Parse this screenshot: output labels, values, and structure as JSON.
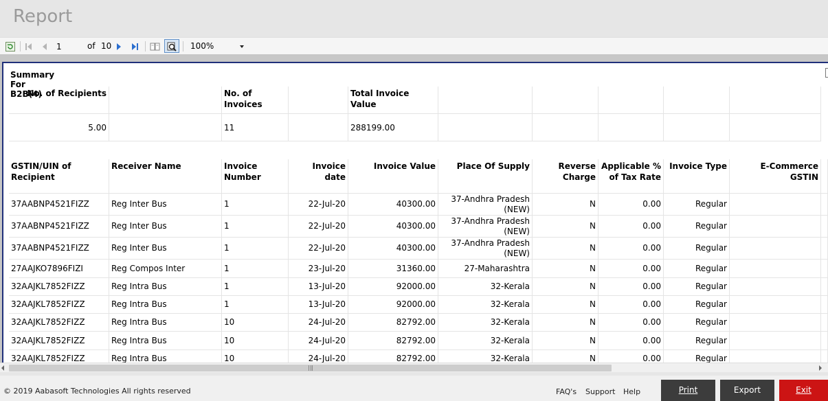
{
  "app": {
    "title": "Report"
  },
  "toolbar": {
    "page_current": "1",
    "of_label": "of",
    "page_total": "10",
    "zoom": "100%"
  },
  "summary": {
    "title": "Summary For B2B(4)",
    "headers": [
      "No. of Recipients",
      "No. of Invoices",
      "Total Invoice Value"
    ],
    "values": [
      "5.00",
      "11",
      "288199.00"
    ]
  },
  "table": {
    "headers": [
      "GSTIN/UIN of Recipient",
      "Receiver Name",
      "Invoice Number",
      "Invoice date",
      "Invoice Value",
      "Place Of Supply",
      "Reverse Charge",
      "Applicable % of Tax Rate",
      "Invoice Type",
      "E-Commerce GSTIN"
    ],
    "rows": [
      [
        "37AABNP4521FIZZ",
        "Reg Inter Bus",
        "1",
        "22-Jul-20",
        "40300.00",
        "37-Andhra Pradesh (NEW)",
        "N",
        "0.00",
        "Regular",
        ""
      ],
      [
        "37AABNP4521FIZZ",
        "Reg Inter Bus",
        "1",
        "22-Jul-20",
        "40300.00",
        "37-Andhra Pradesh (NEW)",
        "N",
        "0.00",
        "Regular",
        ""
      ],
      [
        "37AABNP4521FIZZ",
        "Reg Inter Bus",
        "1",
        "22-Jul-20",
        "40300.00",
        "37-Andhra Pradesh (NEW)",
        "N",
        "0.00",
        "Regular",
        ""
      ],
      [
        "27AAJKO7896FIZI",
        "Reg Compos Inter",
        "1",
        "23-Jul-20",
        "31360.00",
        "27-Maharashtra",
        "N",
        "0.00",
        "Regular",
        ""
      ],
      [
        "32AAJKL7852FIZZ",
        "Reg Intra Bus",
        "1",
        "13-Jul-20",
        "92000.00",
        "32-Kerala",
        "N",
        "0.00",
        "Regular",
        ""
      ],
      [
        "32AAJKL7852FIZZ",
        "Reg Intra Bus",
        "1",
        "13-Jul-20",
        "92000.00",
        "32-Kerala",
        "N",
        "0.00",
        "Regular",
        ""
      ],
      [
        "32AAJKL7852FIZZ",
        "Reg Intra Bus",
        "10",
        "24-Jul-20",
        "82792.00",
        "32-Kerala",
        "N",
        "0.00",
        "Regular",
        ""
      ],
      [
        "32AAJKL7852FIZZ",
        "Reg Intra Bus",
        "10",
        "24-Jul-20",
        "82792.00",
        "32-Kerala",
        "N",
        "0.00",
        "Regular",
        ""
      ],
      [
        "32AAJKL7852FIZZ",
        "Reg Intra Bus",
        "10",
        "24-Jul-20",
        "82792.00",
        "32-Kerala",
        "N",
        "0.00",
        "Regular",
        ""
      ]
    ]
  },
  "footer": {
    "copyright": "© 2019 Aabasoft Technologies All rights reserved",
    "links": [
      "FAQ's",
      "Support",
      "Help"
    ],
    "buttons": {
      "print": "Print",
      "export": "Export",
      "exit": "Exit"
    }
  },
  "colors": {
    "print_bg": "#3c3c3c",
    "export_bg": "#3c3c3c",
    "exit_bg": "#cc1414",
    "frame_border": "#1f2f7a"
  }
}
